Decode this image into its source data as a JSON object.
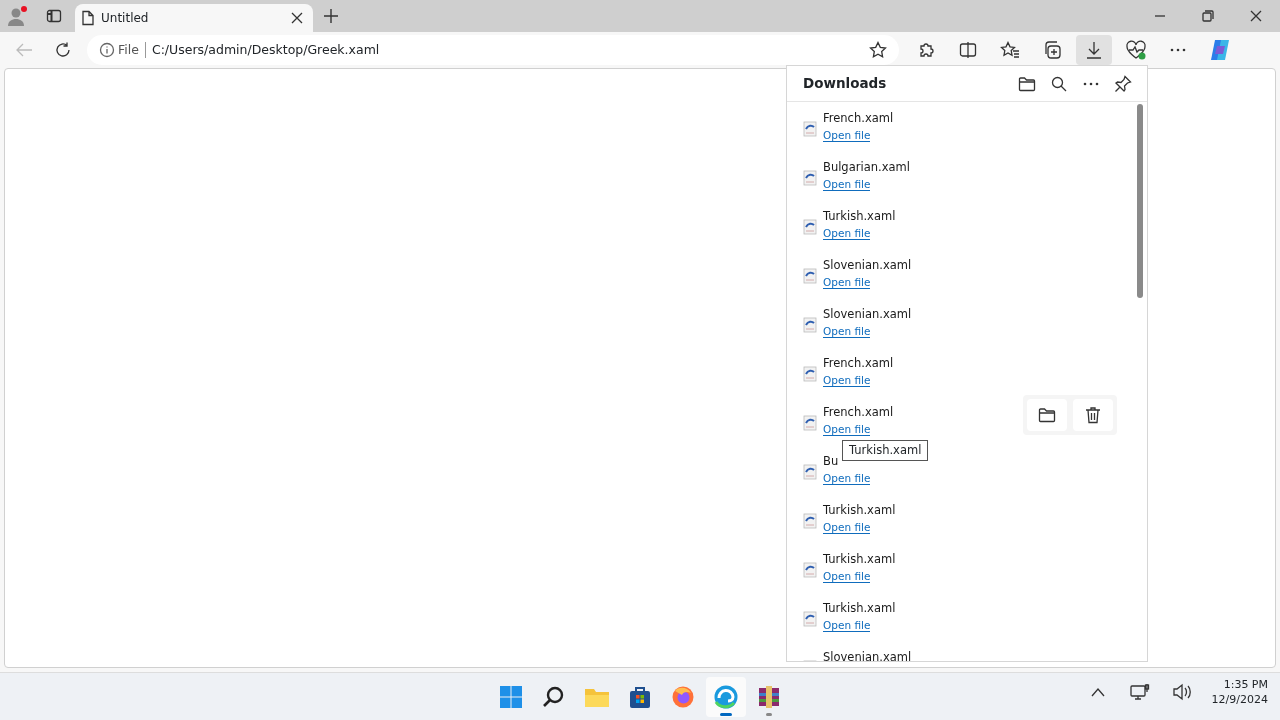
{
  "tabs": [
    {
      "title": "Untitled",
      "selected": true
    }
  ],
  "address": {
    "scheme": "File",
    "url": "C:/Users/admin/Desktop/Greek.xaml"
  },
  "toolbar": {
    "downloads_active": true
  },
  "downloads": {
    "title": "Downloads",
    "items": [
      {
        "name": "French.xaml",
        "action": "Open file",
        "hovered": false
      },
      {
        "name": "Bulgarian.xaml",
        "action": "Open file",
        "hovered": false
      },
      {
        "name": "Turkish.xaml",
        "action": "Open file",
        "hovered": false
      },
      {
        "name": "Slovenian.xaml",
        "action": "Open file",
        "hovered": false
      },
      {
        "name": "Slovenian.xaml",
        "action": "Open file",
        "hovered": false
      },
      {
        "name": "French.xaml",
        "action": "Open file",
        "hovered": false
      },
      {
        "name": "French.xaml",
        "action": "Open file",
        "hovered": true
      },
      {
        "name": "Bu",
        "action": "Open file",
        "hovered": false
      },
      {
        "name": "Turkish.xaml",
        "action": "Open file",
        "hovered": false
      },
      {
        "name": "Turkish.xaml",
        "action": "Open file",
        "hovered": false
      },
      {
        "name": "Turkish.xaml",
        "action": "Open file",
        "hovered": false
      },
      {
        "name": "Slovenian.xaml",
        "hovered": false
      }
    ],
    "tooltip": "Turkish.xaml"
  },
  "taskbar": {
    "apps": [
      {
        "kind": "start",
        "active": false
      },
      {
        "kind": "search",
        "active": false
      },
      {
        "kind": "folder",
        "active": false
      },
      {
        "kind": "store",
        "active": false
      },
      {
        "kind": "firefox",
        "active": false
      },
      {
        "kind": "edge",
        "active": true
      },
      {
        "kind": "archive",
        "active": false
      }
    ],
    "time": "1:35 PM",
    "date": "12/9/2024"
  }
}
